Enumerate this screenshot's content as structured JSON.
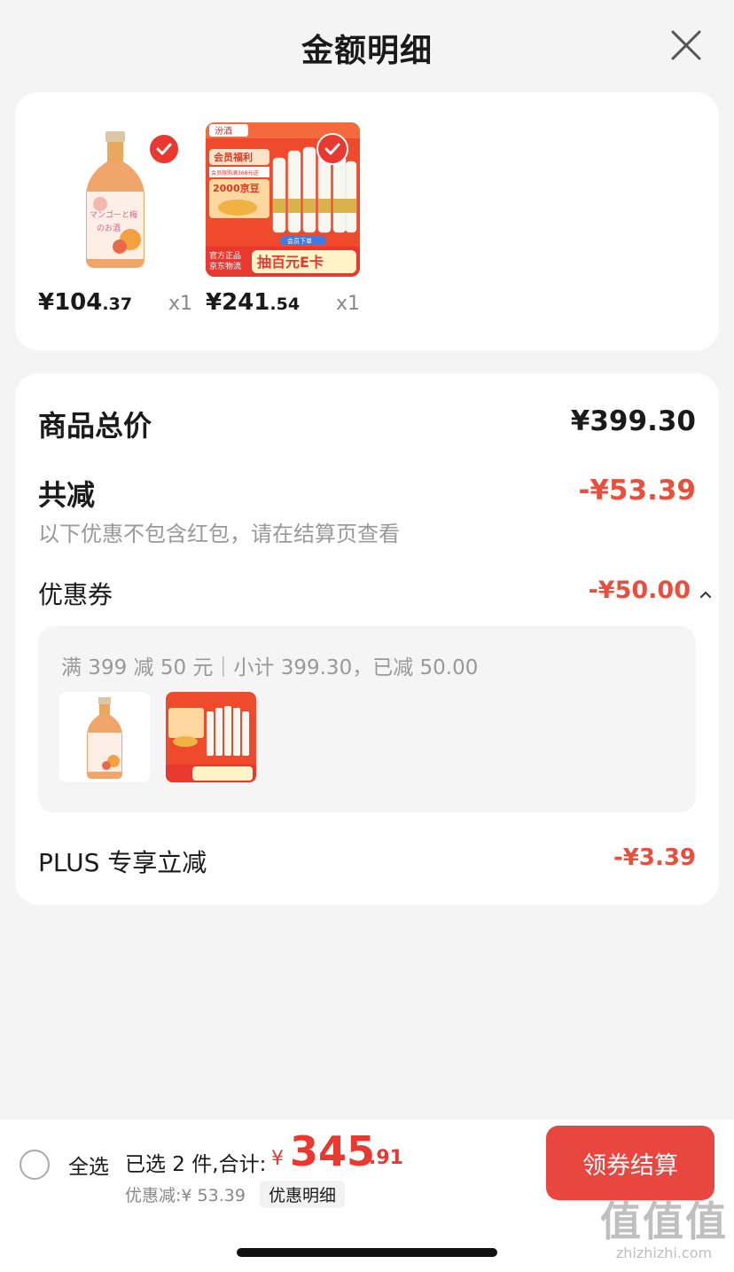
{
  "header": {
    "title": "金额明细"
  },
  "products": [
    {
      "price_int": "¥104",
      "price_dec": ".37",
      "qty": "x1",
      "label_lines": [
        "マンゴーと梅",
        "のお酒"
      ]
    },
    {
      "price_int": "¥241",
      "price_dec": ".54",
      "qty": "x1",
      "badge_top": "汾酒",
      "promo_title": "会员福利",
      "promo_sub": "会员限购满368元送",
      "promo_value": "2000京豆",
      "promo_bottom_left": [
        "官方正品",
        "京东物流"
      ],
      "promo_bottom_main": "抽百元E卡",
      "promo_strip": "会员下单"
    }
  ],
  "summary": {
    "total_label": "商品总价",
    "total_value": "¥399.30",
    "reduce_label": "共减",
    "reduce_value": "-¥53.39",
    "note": "以下优惠不包含红包，请在结算页查看",
    "coupon_label": "优惠券",
    "coupon_value": "-¥50.00",
    "coupon_desc": "满 399 减 50 元｜小计 399.30，已减 50.00",
    "plus_label": "PLUS 专享立减",
    "plus_value": "-¥3.39"
  },
  "bottom": {
    "select_all": "全选",
    "selected_text": "已选 2 件,合计:",
    "currency": "¥",
    "total_int": "345",
    "total_dec": ".91",
    "discount_text": "优惠减:¥ 53.39",
    "detail_tag": "优惠明细",
    "pay_button": "领券结算"
  },
  "watermark": {
    "big": "值值值",
    "small": "zhizhizhi.com"
  },
  "icons": {
    "close": "close-icon",
    "check": "checkmark-icon",
    "chevron": "chevron-up-icon"
  },
  "colors": {
    "accent": "#e8382f",
    "discount": "#e84f3d"
  }
}
